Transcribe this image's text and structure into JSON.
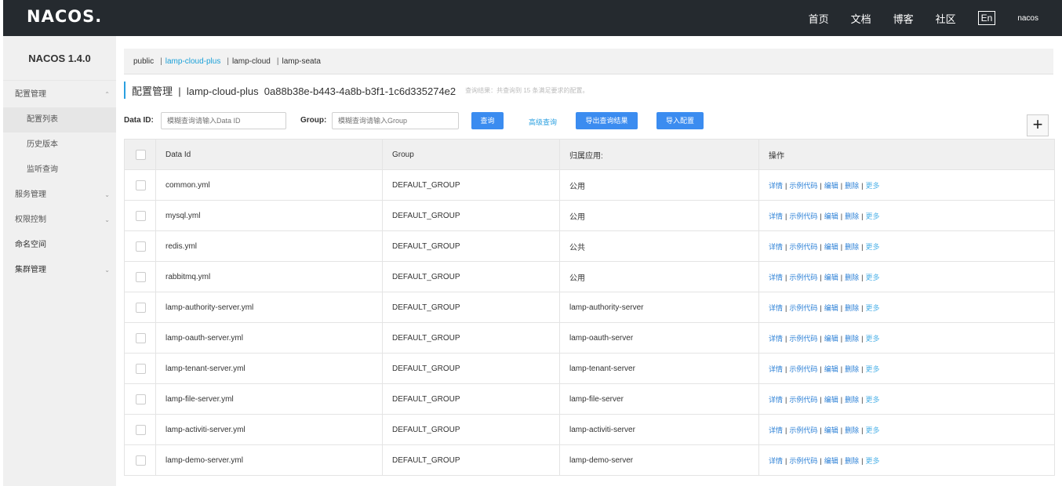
{
  "header": {
    "logo": "NACOS.",
    "nav": [
      "首页",
      "文档",
      "博客",
      "社区"
    ],
    "lang": "En",
    "user": "nacos"
  },
  "sidebar": {
    "version": "NACOS 1.4.0",
    "items": [
      {
        "label": "配置管理",
        "chevron": "^"
      },
      {
        "label": "配置列表"
      },
      {
        "label": "历史版本"
      },
      {
        "label": "监听查询"
      },
      {
        "label": "服务管理",
        "chevron": "v"
      },
      {
        "label": "权限控制",
        "chevron": "v"
      },
      {
        "label": "命名空间"
      },
      {
        "label": "集群管理",
        "chevron": "v"
      }
    ]
  },
  "namespaces": [
    "public",
    "lamp-cloud-plus",
    "lamp-cloud",
    "lamp-seata"
  ],
  "page": {
    "title": "配置管理  |  lamp-cloud-plus  0a88b38e-b443-4a8b-b3f1-1c6d335274e2",
    "result": "查询结果：共查询到 15 条满足要求的配置。"
  },
  "search": {
    "dataid_label": "Data ID:",
    "dataid_placeholder": "模糊查询请输入Data ID",
    "group_label": "Group:",
    "group_placeholder": "模糊查询请输入Group",
    "query_btn": "查询",
    "advanced": "高级查询",
    "export_btn": "导出查询结果",
    "import_btn": "导入配置",
    "plus": "+"
  },
  "table": {
    "headers": [
      "Data Id",
      "Group",
      "归属应用:",
      "操作"
    ],
    "ops": [
      "详情",
      "示例代码",
      "编辑",
      "删除",
      "更多"
    ],
    "rows": [
      {
        "data_id": "common.yml",
        "group": "DEFAULT_GROUP",
        "app": "公用"
      },
      {
        "data_id": "mysql.yml",
        "group": "DEFAULT_GROUP",
        "app": "公用"
      },
      {
        "data_id": "redis.yml",
        "group": "DEFAULT_GROUP",
        "app": "公共"
      },
      {
        "data_id": "rabbitmq.yml",
        "group": "DEFAULT_GROUP",
        "app": "公用"
      },
      {
        "data_id": "lamp-authority-server.yml",
        "group": "DEFAULT_GROUP",
        "app": "lamp-authority-server"
      },
      {
        "data_id": "lamp-oauth-server.yml",
        "group": "DEFAULT_GROUP",
        "app": "lamp-oauth-server"
      },
      {
        "data_id": "lamp-tenant-server.yml",
        "group": "DEFAULT_GROUP",
        "app": "lamp-tenant-server"
      },
      {
        "data_id": "lamp-file-server.yml",
        "group": "DEFAULT_GROUP",
        "app": "lamp-file-server"
      },
      {
        "data_id": "lamp-activiti-server.yml",
        "group": "DEFAULT_GROUP",
        "app": "lamp-activiti-server"
      },
      {
        "data_id": "lamp-demo-server.yml",
        "group": "DEFAULT_GROUP",
        "app": "lamp-demo-server"
      }
    ]
  },
  "colors": {
    "topbar": "#252a2f",
    "primary": "#3b8cf0",
    "accent": "#2aa0e0",
    "sidebar": "#f0f0f0"
  }
}
